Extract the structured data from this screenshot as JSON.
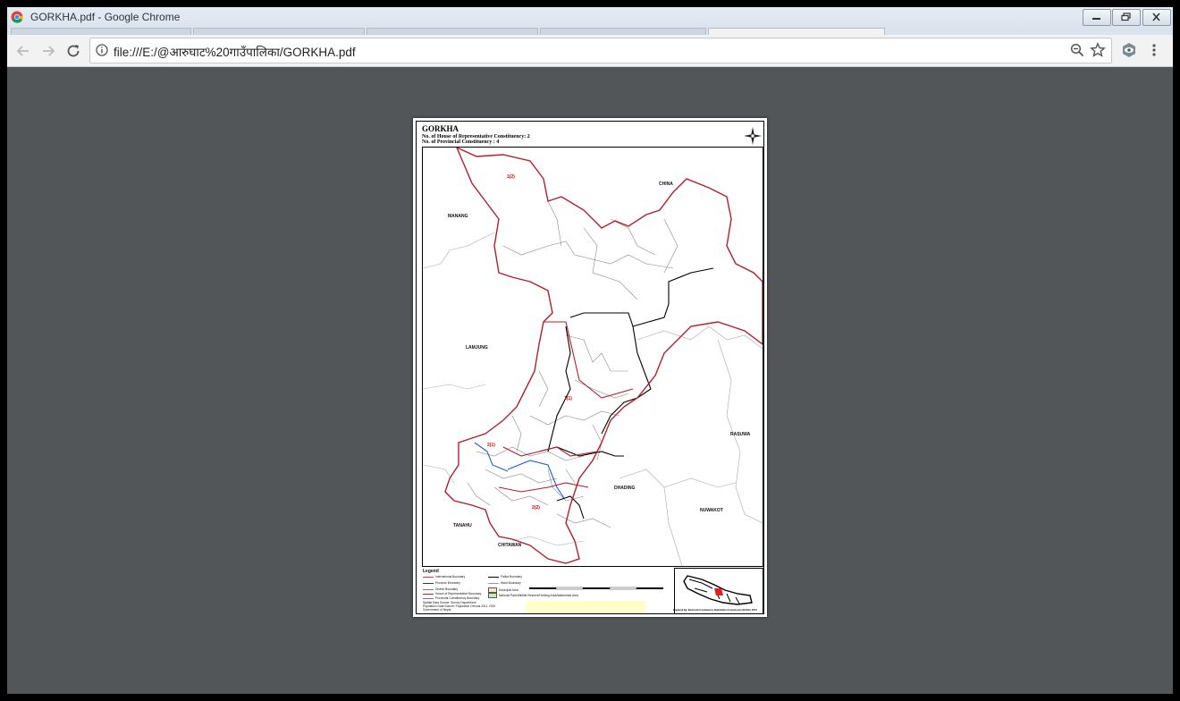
{
  "window": {
    "title": "GORKHA.pdf - Google Chrome"
  },
  "toolbar": {
    "url": "file:///E:/@आरुघाट%20गाउँपालिका/GORKHA.pdf"
  },
  "pdf": {
    "map_title": "GORKHA",
    "line1": "No. of House of Representative Constituency: 2",
    "line2": "No. of Provincial Constituency : 4",
    "labels": {
      "china": "CHINA",
      "manang": "MANANG",
      "lamjung": "LAMJUNG",
      "rasuwa": "RASUWA",
      "dhading": "DHADING",
      "nuwakot": "NUWAKOT",
      "tanahu": "TANAHU",
      "chitawan": "CHITAWAN",
      "c12": "1(2)",
      "c11": "1(1)",
      "c21": "2(1)",
      "c22": "2(2)"
    },
    "legend": {
      "title": "Legend",
      "items": [
        "International Boundary",
        "Province Boundary",
        "District Boundary",
        "House of Representative Boundary",
        "Provincial Constituency Boundary",
        "Palika Boundary",
        "Ward Boundary",
        "Municipal Area",
        "National Park/Wildlife Reserve/Hunting Area/Watershed Area"
      ],
      "source": "Spatial Data Source: Survey Department",
      "pop_source": "Population Data Source: Population Census 2011, CBS",
      "govt": "Government of Nepal",
      "prepared": "Prepared By: Electoral Constituency Delimitation Commission (ECDC), 2074"
    }
  }
}
